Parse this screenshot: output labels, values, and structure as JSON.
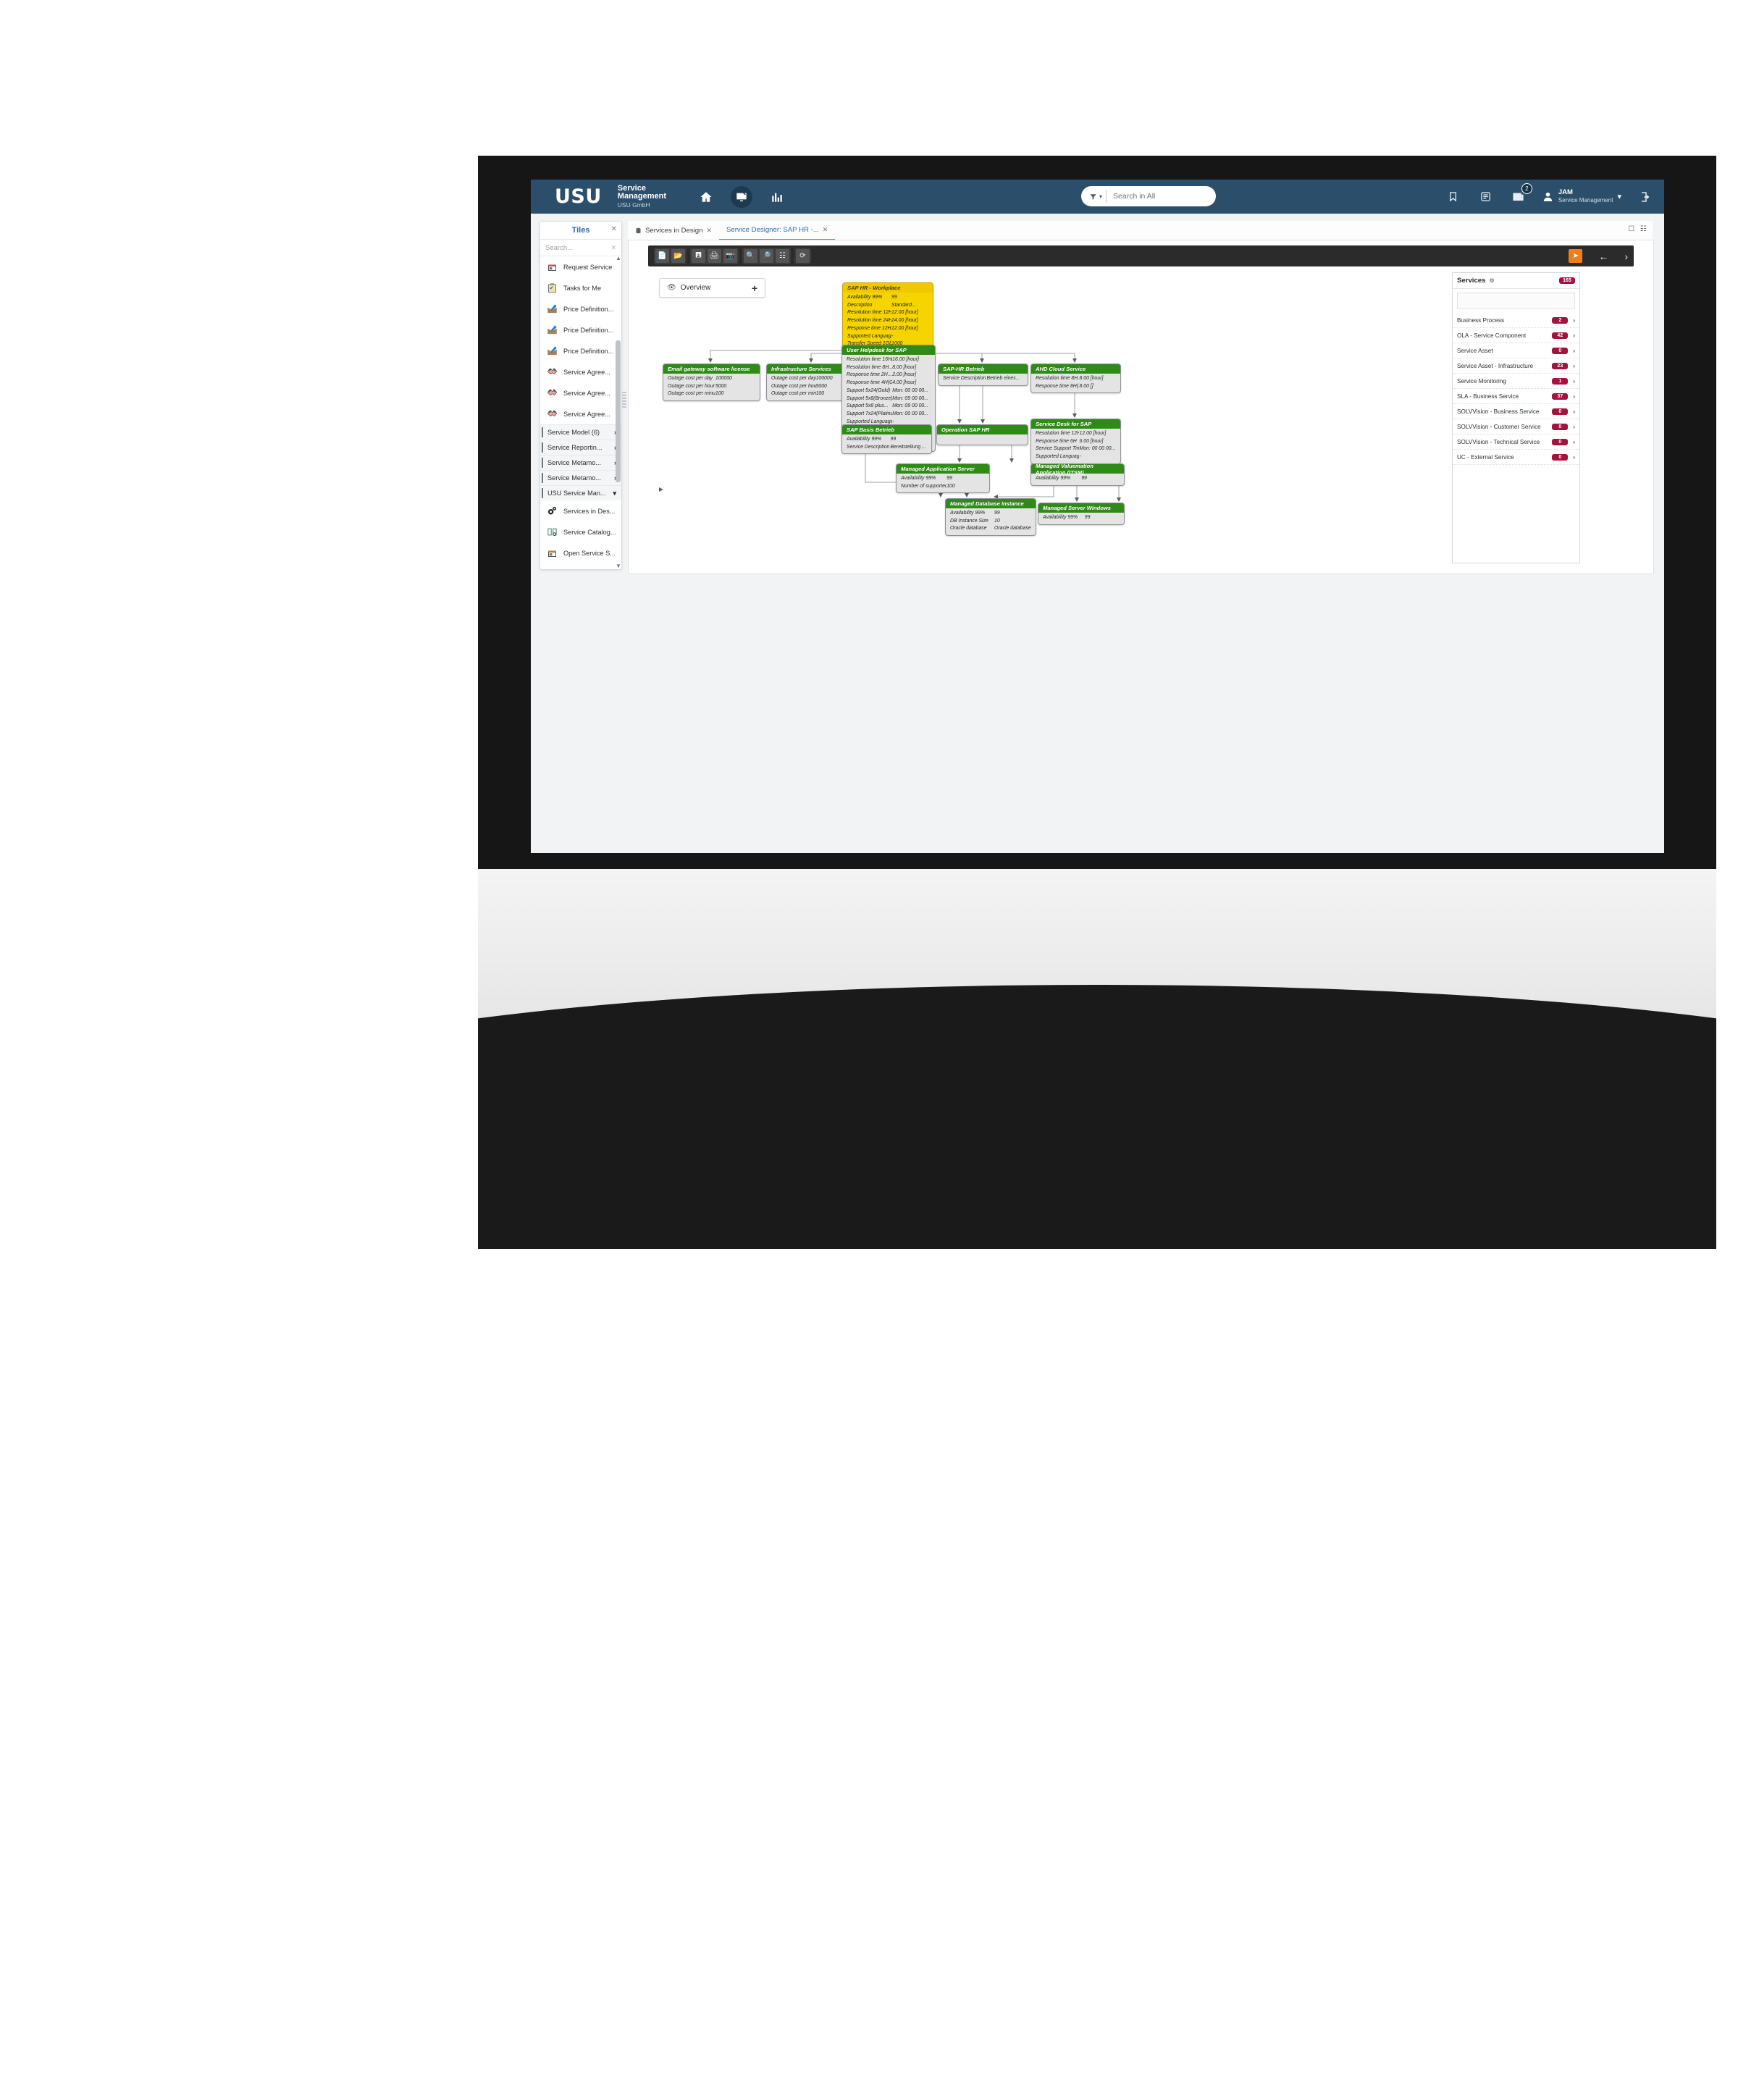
{
  "header": {
    "logo": "USU",
    "brand_line1": "Service",
    "brand_line2": "Management",
    "brand_sub": "USU GmbH",
    "icons": [
      "home-icon",
      "service-desk-icon",
      "reports-icon"
    ],
    "search": {
      "placeholder": "Search in All",
      "value": "",
      "selector_icon": "filter-icon"
    },
    "right_icons": [
      "bookmark-icon",
      "notes-icon",
      "news-icon"
    ],
    "news_badge": "2",
    "user_name": "JAM",
    "user_role": "Service Management",
    "logout_icon": "logout-icon"
  },
  "tiles_panel": {
    "title": "Tiles",
    "close_icon": "close-icon",
    "search_placeholder": "Search...",
    "search_clear_icon": "close-icon",
    "items": [
      {
        "label": "Request Service",
        "icon": "shop-icon",
        "type": "item"
      },
      {
        "label": "Tasks for Me",
        "icon": "clipboard-icon",
        "type": "item"
      },
      {
        "label": "Price Definition...",
        "icon": "price-edit-icon",
        "type": "item"
      },
      {
        "label": "Price Definition...",
        "icon": "price-edit-icon",
        "type": "item"
      },
      {
        "label": "Price Definition...",
        "icon": "price-edit-icon",
        "type": "item"
      },
      {
        "label": "Service Agree...",
        "icon": "handshake-icon",
        "type": "item"
      },
      {
        "label": "Service Agree...",
        "icon": "handshake-icon",
        "type": "item"
      },
      {
        "label": "Service Agree...",
        "icon": "handshake-icon",
        "type": "item"
      },
      {
        "label": "Service Model (6)",
        "icon": "chevron-right-icon",
        "type": "group"
      },
      {
        "label": "Service Reportin...",
        "icon": "chevron-right-icon",
        "type": "group"
      },
      {
        "label": "Service Metamo...",
        "icon": "chevron-right-icon",
        "type": "group"
      },
      {
        "label": "Service Metamo...",
        "icon": "chevron-right-icon",
        "type": "group"
      },
      {
        "label": "USU Service Man...",
        "icon": "chevron-down-icon",
        "type": "group"
      },
      {
        "label": "Services in Des...",
        "icon": "gears-icon",
        "type": "item"
      },
      {
        "label": "Service Catalog...",
        "icon": "book-gear-icon",
        "type": "item"
      },
      {
        "label": "Open Service S...",
        "icon": "shop-orange-icon",
        "type": "item"
      }
    ]
  },
  "tabs": [
    {
      "label": "Services in Design",
      "icon": "db-icon",
      "close_icon": "close-icon",
      "active": false
    },
    {
      "label": "Service Designer: SAP HR -...",
      "close_icon": "close-icon",
      "active": true
    }
  ],
  "window_icons": [
    "restore-icon",
    "popout-icon"
  ],
  "toolbar": {
    "groups": [
      [
        "new-file-icon",
        "open-folder-icon"
      ],
      [
        "save-icon",
        "print-icon",
        "snapshot-icon"
      ],
      [
        "zoom-in-icon",
        "zoom-out-icon",
        "fit-icon"
      ],
      [
        "refresh-icon"
      ]
    ],
    "right": {
      "highlight_icon": "pointer-icon",
      "back_icon": "arrow-left-icon",
      "forward_icon": "arrow-right-icon"
    }
  },
  "overview_control": {
    "eye_icon": "eye-icon",
    "label": "Overview",
    "add_icon": "plus-icon"
  },
  "diagram": {
    "nodes": [
      {
        "id": "sap-hr-workplace",
        "title": "SAP HR - Workplace",
        "color": "yellow",
        "rows": [
          {
            "k": "Availability 99%",
            "v": "99"
          },
          {
            "k": "Description",
            "v": "Standard..."
          },
          {
            "k": "Resolution time 12H",
            "v": "12.00 [hour]"
          },
          {
            "k": "Resolution time 24H...",
            "v": "24.00 [hour]"
          },
          {
            "k": "Response time 12H(Bronze)",
            "v": "12.00 [hour]"
          },
          {
            "k": "Supported Language DE...",
            "v": "-"
          },
          {
            "k": "Transfer Speed 1Gb/Sec",
            "v": "1000"
          }
        ]
      },
      {
        "id": "email-gateway",
        "title": "Email gateway software license",
        "color": "green",
        "rows": [
          {
            "k": "Outage cost per day",
            "v": "100000"
          },
          {
            "k": "Outage cost per hour",
            "v": "5000"
          },
          {
            "k": "Outage cost per minute",
            "v": "100"
          }
        ]
      },
      {
        "id": "infrastructure-services",
        "title": "Infrastructure Services",
        "color": "green",
        "rows": [
          {
            "k": "Outage cost per day",
            "v": "100000"
          },
          {
            "k": "Outage cost per hour",
            "v": "5000"
          },
          {
            "k": "Outage cost per minute",
            "v": "100"
          }
        ]
      },
      {
        "id": "user-helpdesk-sap",
        "title": "User Helpdesk for SAP",
        "color": "green",
        "rows": [
          {
            "k": "Resolution time 16H(Gold)",
            "v": "16.00 [hour]"
          },
          {
            "k": "Resolution time 8H...",
            "v": "8.00 [hour]"
          },
          {
            "k": "Response time 2H...",
            "v": "2.00 [hour]"
          },
          {
            "k": "Response time 4H(Gold)",
            "v": "4.00 [hour]"
          },
          {
            "k": "Support 5x24(Gold)",
            "v": "Mon: 00 00 00..."
          },
          {
            "k": "Support 5x8(Bronze)",
            "v": "Mon: 09 00 00..."
          },
          {
            "k": "Support 5x8 plus...",
            "v": "Mon: 09 00 00..."
          },
          {
            "k": "Support 7x24(Platinum)",
            "v": "Mon: 00 00 00..."
          },
          {
            "k": "Supported Language DE...",
            "v": "-"
          },
          {
            "k": "Supported Language DE...",
            "v": "-"
          },
          {
            "k": "Supported Language DE...",
            "v": "-"
          },
          {
            "k": "Supported Language DE...",
            "v": "-"
          }
        ]
      },
      {
        "id": "sap-hr-betrieb",
        "title": "SAP-HR Betrieb",
        "color": "green",
        "rows": [
          {
            "k": "Service Description",
            "v": "Betrieb eines..."
          }
        ]
      },
      {
        "id": "ahd-cloud-service",
        "title": "AHD Cloud Service",
        "color": "green",
        "rows": [
          {
            "k": "Resolution time 8H...",
            "v": "8.00 [hour]"
          },
          {
            "k": "Response time 8H(Silver)",
            "v": "8.00 []"
          }
        ]
      },
      {
        "id": "sap-basis-betrieb",
        "title": "SAP Basis Betrieb",
        "color": "green",
        "rows": [
          {
            "k": "Availability 99%",
            "v": "99"
          },
          {
            "k": "Service Description",
            "v": "Bereitstellung ..."
          }
        ]
      },
      {
        "id": "operation-sap-hr",
        "title": "Operation SAP HR",
        "color": "green",
        "rows": [
          {
            "k": "",
            "v": ""
          }
        ]
      },
      {
        "id": "service-desk-sap",
        "title": "Service Desk for SAP",
        "color": "green",
        "rows": [
          {
            "k": "Resolution time 12H",
            "v": "12.00 [hour]"
          },
          {
            "k": "Response time 6H",
            "v": "6.00 [hour]"
          },
          {
            "k": "Service Support Time 24x7",
            "v": "Mon: 00 00 00..."
          },
          {
            "k": "Supported Language DE,EN",
            "v": "-"
          }
        ]
      },
      {
        "id": "managed-application-server",
        "title": "Managed Application Server",
        "color": "green",
        "rows": [
          {
            "k": "Availability 99%",
            "v": "99"
          },
          {
            "k": "Number of supported users",
            "v": "100"
          }
        ]
      },
      {
        "id": "managed-valuemation-application",
        "title": "Managed Valuemation Application (ITSM)",
        "color": "green",
        "rows": [
          {
            "k": "Availability 99%",
            "v": "99"
          }
        ]
      },
      {
        "id": "managed-database-instance",
        "title": "Managed Database Instance",
        "color": "green",
        "rows": [
          {
            "k": "Availability 99%",
            "v": "99"
          },
          {
            "k": "DB Instance Size",
            "v": "10"
          },
          {
            "k": "Oracle database",
            "v": "Oracle database"
          }
        ]
      },
      {
        "id": "managed-server-windows",
        "title": "Managed Server Windows",
        "color": "green",
        "rows": [
          {
            "k": "Availability 99%",
            "v": "99"
          }
        ]
      }
    ]
  },
  "services_panel": {
    "title": "Services",
    "gear_icon": "gear-icon",
    "total_badge": "165",
    "search_value": "",
    "rows": [
      {
        "label": "Business Process",
        "count": "2",
        "chevron": "chevron-right-icon"
      },
      {
        "label": "OLA - Service Component",
        "count": "42",
        "chevron": "chevron-right-icon"
      },
      {
        "label": "Service Asset",
        "count": "0",
        "chevron": "chevron-right-icon"
      },
      {
        "label": "Service Asset - Infrastructure",
        "count": "23",
        "chevron": "chevron-right-icon"
      },
      {
        "label": "Service Monitoring",
        "count": "1",
        "chevron": "chevron-right-icon"
      },
      {
        "label": "SLA - Business Service",
        "count": "37",
        "chevron": "chevron-right-icon"
      },
      {
        "label": "SOLVVision - Business Service",
        "count": "0",
        "chevron": "chevron-right-icon"
      },
      {
        "label": "SOLVVision - Customer Service",
        "count": "0",
        "chevron": "chevron-right-icon"
      },
      {
        "label": "SOLVVision - Technical Service",
        "count": "0",
        "chevron": "chevron-right-icon"
      },
      {
        "label": "UC - External Service",
        "count": "0",
        "chevron": "chevron-right-icon"
      }
    ]
  },
  "colors": {
    "topbar": "#2b4f6b",
    "node_green": "#2f8a18",
    "node_yellow": "#f5d400",
    "badge": "#a4123f",
    "accent": "#2f6fa8",
    "toolbar_highlight": "#ef7f1a"
  }
}
